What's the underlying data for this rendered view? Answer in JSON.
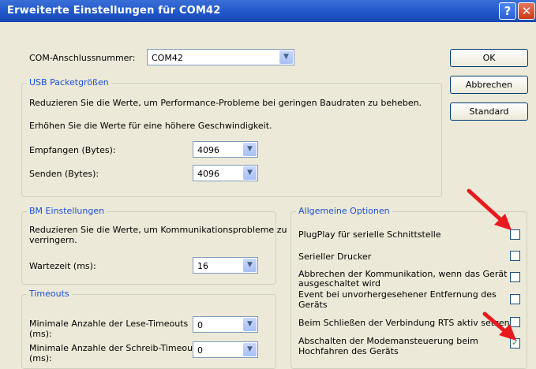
{
  "window": {
    "title": "Erweiterte Einstellungen für COM42"
  },
  "com_port": {
    "label": "COM-Anschlussnummer:",
    "value": "COM42"
  },
  "buttons": {
    "ok": "OK",
    "cancel": "Abbrechen",
    "standard": "Standard"
  },
  "usb": {
    "legend": "USB Packetgrößen",
    "desc1": "Reduzieren Sie die Werte, um Performance-Probleme bei geringen Baudraten zu beheben.",
    "desc2": "Erhöhen Sie die Werte für eine höhere Geschwindigkeit.",
    "receive_label": "Empfangen (Bytes):",
    "receive_value": "4096",
    "send_label": "Senden (Bytes):",
    "send_value": "4096"
  },
  "bm": {
    "legend": "BM Einstellungen",
    "desc_line1": "Reduzieren Sie die Werte, um Kommunikationsprobleme zu",
    "desc_line2": "verringern.",
    "wait_label": "Wartezeit (ms):",
    "wait_value": "16"
  },
  "timeouts": {
    "legend": "Timeouts",
    "read_line1": "Minimale Anzahle der Lese-Timeouts",
    "read_line2": "(ms):",
    "read_value": "0",
    "write_line1": "Minimale Anzahle der Schreib-Timeouts",
    "write_line2": "(ms):",
    "write_value": "0"
  },
  "options": {
    "legend": "Allgemeine Optionen",
    "items": [
      {
        "line1": "PlugPlay für serielle Schnittstelle",
        "line2": "",
        "checked": false
      },
      {
        "line1": "Serieller Drucker",
        "line2": "",
        "checked": false
      },
      {
        "line1": "Abbrechen der Kommunikation, wenn das Gerät",
        "line2": "ausgeschaltet wird",
        "checked": false
      },
      {
        "line1": "Event bei unvorhergesehener Entfernung des",
        "line2": "Geräts",
        "checked": false
      },
      {
        "line1": "Beim Schließen der Verbindung RTS aktiv setzen",
        "line2": "",
        "checked": false
      },
      {
        "line1": "Abschalten der Modemansteuerung beim",
        "line2": "Hochfahren des Geräts",
        "checked": true
      }
    ]
  },
  "colors": {
    "title_bar": "#1f55c9",
    "annotation_arrow": "#e8191f",
    "legend_text": "#1c4ed8"
  }
}
